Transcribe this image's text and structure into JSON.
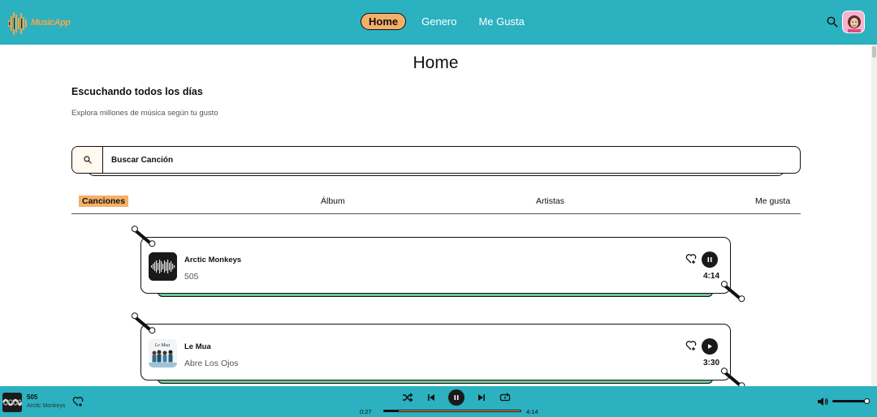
{
  "header": {
    "logo_text": "MusicApp",
    "nav": [
      {
        "label": "Home",
        "active": true
      },
      {
        "label": "Genero",
        "active": false
      },
      {
        "label": "Me Gusta",
        "active": false
      }
    ]
  },
  "main": {
    "title": "Home",
    "subtitle": "Escuchando todos los días",
    "description": "Explora millones de música según tu gusto",
    "search": {
      "placeholder": "Buscar Canción"
    },
    "tabs": [
      "Canciones",
      "Álbum",
      "Artistas",
      "Me gusta"
    ],
    "songs": [
      {
        "title": "Arctic Monkeys",
        "artist": "505",
        "duration": "4:14",
        "state": "playing"
      },
      {
        "title": "Le Mua",
        "artist": "Abre Los Ojos",
        "duration": "3:30",
        "state": "paused"
      }
    ]
  },
  "player": {
    "title": "505",
    "artist": "Arctic Monkeys",
    "current_time": "0:27",
    "total_time": "4:14",
    "progress_fraction": 0.11,
    "volume_fraction": 0.95
  },
  "colors": {
    "accent": "#2bb1c0",
    "highlight": "#f4b069",
    "card_shadow": "#6dc39a"
  }
}
